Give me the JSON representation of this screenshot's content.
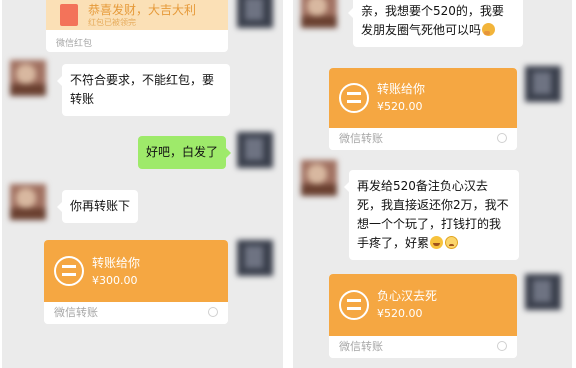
{
  "left": {
    "redpacket": {
      "title": "恭喜发财，大吉大利",
      "subtitle": "红包已被领完",
      "footer": "微信红包"
    },
    "msg1": "不符合要求，不能红包，要转账",
    "msg2": "好吧，白发了",
    "msg3": "你再转账下",
    "transfer": {
      "title": "转账给你",
      "amount": "¥300.00",
      "footer": "微信转账"
    }
  },
  "right": {
    "msg1": "亲，我想要个520的，我要发朋友圈气死他可以吗",
    "transfer1": {
      "title": "转账给你",
      "amount": "¥520.00",
      "footer": "微信转账"
    },
    "msg2": "再发给520备注负心汉去死，我直接返还你2万，我不想一个个玩了，打钱打的我手疼了，好累",
    "transfer2": {
      "title": "负心汉去死",
      "amount": "¥520.00",
      "footer": "微信转账"
    }
  },
  "icons": {
    "transfer": "transfer-arrows-icon",
    "redpacket": "red-packet-icon",
    "smiley": "emoji-laughing-tears",
    "sad": "emoji-sad",
    "think": "emoji-thinking"
  },
  "colors": {
    "orange": "#f5a742",
    "green": "#9eea6a",
    "bg": "#ebebeb"
  }
}
